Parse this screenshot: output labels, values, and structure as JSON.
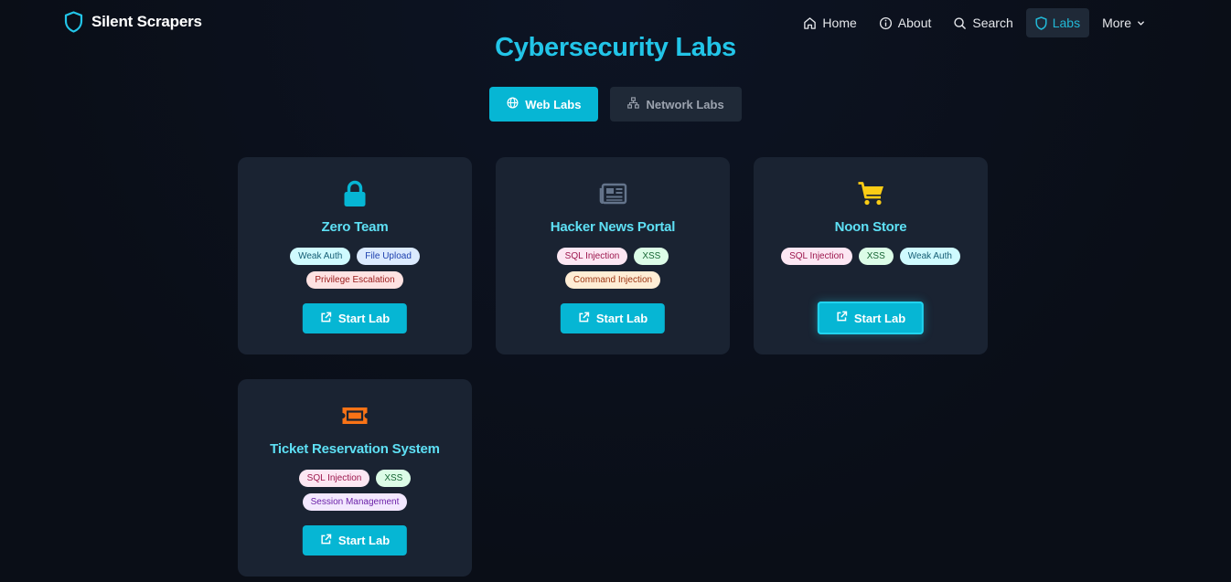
{
  "brand": {
    "name": "Silent Scrapers"
  },
  "nav": {
    "home": "Home",
    "about": "About",
    "search": "Search",
    "labs": "Labs",
    "more": "More"
  },
  "page": {
    "title": "Cybersecurity Labs"
  },
  "tabs": {
    "web": "Web Labs",
    "network": "Network Labs",
    "active": "web"
  },
  "labs": [
    {
      "title": "Zero Team",
      "icon": "lock-icon",
      "icon_color": "#06b6d4",
      "tags": [
        "Weak Auth",
        "File Upload",
        "Privilege Escalation"
      ],
      "button": "Start Lab"
    },
    {
      "title": "Hacker News Portal",
      "icon": "newspaper-icon",
      "icon_color": "#64748b",
      "tags": [
        "SQL Injection",
        "XSS",
        "Command Injection"
      ],
      "button": "Start Lab"
    },
    {
      "title": "Noon Store",
      "icon": "cart-icon",
      "icon_color": "#facc15",
      "tags": [
        "SQL Injection",
        "XSS",
        "Weak Auth"
      ],
      "button": "Start Lab"
    },
    {
      "title": "Ticket Reservation System",
      "icon": "ticket-icon",
      "icon_color": "#f97316",
      "tags": [
        "SQL Injection",
        "XSS",
        "Session Management"
      ],
      "button": "Start Lab"
    }
  ],
  "colors": {
    "accent": "#06b6d4",
    "title": "#22c5e8",
    "card": "#1a2332",
    "background": "#0b0f19"
  }
}
